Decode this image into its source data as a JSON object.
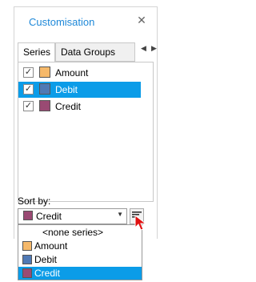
{
  "panel": {
    "title": "Customisation",
    "close_icon": "close-icon"
  },
  "tabs": [
    {
      "label": "Series",
      "active": true
    },
    {
      "label": "Data Groups",
      "active": false
    }
  ],
  "series": [
    {
      "label": "Amount",
      "checked": true,
      "color": "#f6b96a",
      "selected": false
    },
    {
      "label": "Debit",
      "checked": true,
      "color": "#4f79b5",
      "selected": true
    },
    {
      "label": "Credit",
      "checked": true,
      "color": "#9a4a73",
      "selected": false
    }
  ],
  "sort": {
    "label": "Sort by:",
    "selected": "Credit",
    "selected_color": "#9a4a73",
    "options": [
      {
        "label": "<none series>"
      },
      {
        "label": "Amount",
        "color": "#f6b96a"
      },
      {
        "label": "Debit",
        "color": "#4f79b5"
      },
      {
        "label": "Credit",
        "color": "#9a4a73",
        "highlighted": true
      }
    ]
  },
  "colors": {
    "accent": "#1e88d8",
    "selection": "#0b9ce8"
  }
}
